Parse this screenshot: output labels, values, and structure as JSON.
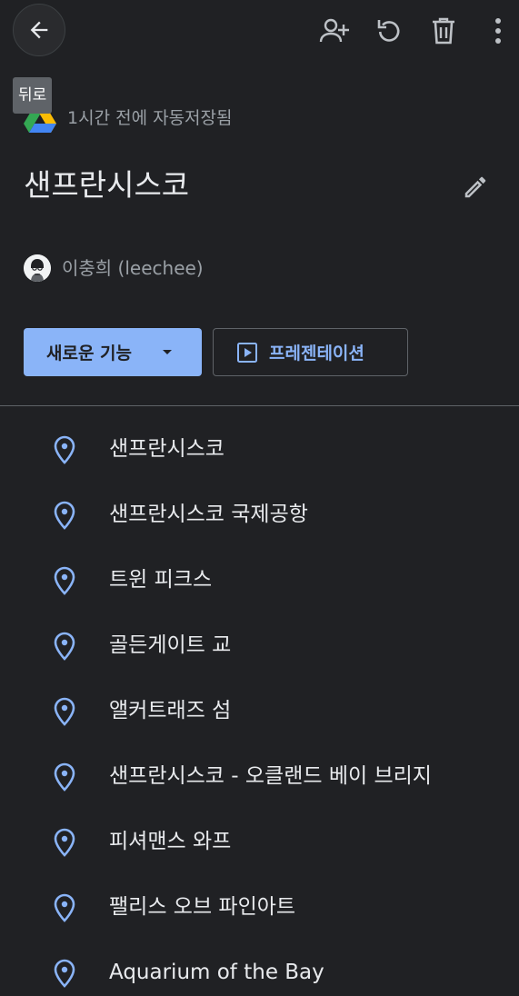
{
  "header": {
    "back_tooltip": "뒤로",
    "autosave_text": "1시간 전에 자동저장됨"
  },
  "map": {
    "title": "샌프란시스코",
    "owner": "이충희 (leechee)"
  },
  "actions": {
    "new_feature_label": "새로운 기능",
    "presentation_label": "프레젠테이션"
  },
  "places": [
    {
      "name": "샌프란시스코"
    },
    {
      "name": "샌프란시스코 국제공항"
    },
    {
      "name": "트윈 피크스"
    },
    {
      "name": "골든게이트 교"
    },
    {
      "name": "앨커트래즈 섬"
    },
    {
      "name": "샌프란시스코 - 오클랜드 베이 브리지"
    },
    {
      "name": "피셔맨스 와프"
    },
    {
      "name": "팰리스 오브 파인아트"
    },
    {
      "name": "Aquarium of the Bay"
    }
  ],
  "colors": {
    "background": "#202124",
    "accent": "#8ab4f8",
    "text": "#e8eaed",
    "muted": "#9aa0a6"
  },
  "icons": [
    "back-arrow-icon",
    "add-person-icon",
    "refresh-icon",
    "trash-icon",
    "more-vert-icon",
    "drive-icon",
    "pencil-icon",
    "play-icon",
    "place-pin-icon",
    "chevron-down-icon"
  ]
}
